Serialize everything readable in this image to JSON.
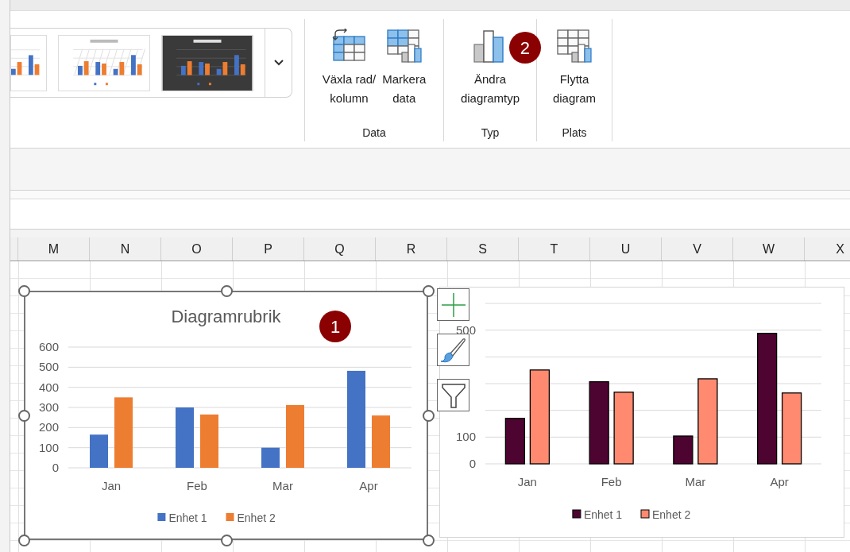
{
  "ribbon": {
    "gallery": {
      "styles": [
        {
          "kind": "plain"
        },
        {
          "kind": "hatched"
        },
        {
          "kind": "dark"
        }
      ]
    },
    "groups": [
      {
        "label": "Data",
        "buttons": [
          {
            "lines": [
              "Växla rad/",
              "kolumn"
            ]
          },
          {
            "lines": [
              "Markera",
              "data"
            ]
          }
        ]
      },
      {
        "label": "Typ",
        "buttons": [
          {
            "lines": [
              "Ändra",
              "diagramtyp"
            ],
            "callout": "2"
          }
        ]
      },
      {
        "label": "Plats",
        "buttons": [
          {
            "lines": [
              "Flytta",
              "diagram"
            ]
          }
        ]
      }
    ]
  },
  "columns": [
    "M",
    "N",
    "O",
    "P",
    "Q",
    "R",
    "S",
    "T",
    "U",
    "V",
    "W",
    "X"
  ],
  "charts": [
    {
      "selected": true,
      "callout": "1",
      "chart_data": {
        "type": "bar",
        "title": "Diagramrubrik",
        "categories": [
          "Jan",
          "Feb",
          "Mar",
          "Apr"
        ],
        "series": [
          {
            "name": "Enhet 1",
            "color": "#4472c4",
            "values": [
              165,
              300,
              100,
              482
            ]
          },
          {
            "name": "Enhet 2",
            "color": "#ed7d31",
            "values": [
              350,
              265,
              312,
              260
            ]
          }
        ],
        "ylim": [
          0,
          600
        ],
        "yticks": [
          0,
          100,
          200,
          300,
          400,
          500,
          600
        ],
        "grid": true,
        "legend": "bottom"
      }
    },
    {
      "selected": false,
      "chart_data": {
        "type": "bar",
        "categories": [
          "Jan",
          "Feb",
          "Mar",
          "Apr"
        ],
        "series": [
          {
            "name": "Enhet 1",
            "color": "#4e0430",
            "values": [
              170,
              307,
              104,
              488
            ]
          },
          {
            "name": "Enhet 2",
            "color": "#ff8a70",
            "values": [
              351,
              268,
              318,
              265
            ]
          }
        ],
        "ylim": [
          0,
          600
        ],
        "yticks": [
          0,
          100,
          500
        ],
        "grid": true,
        "legend": "bottom"
      }
    }
  ]
}
